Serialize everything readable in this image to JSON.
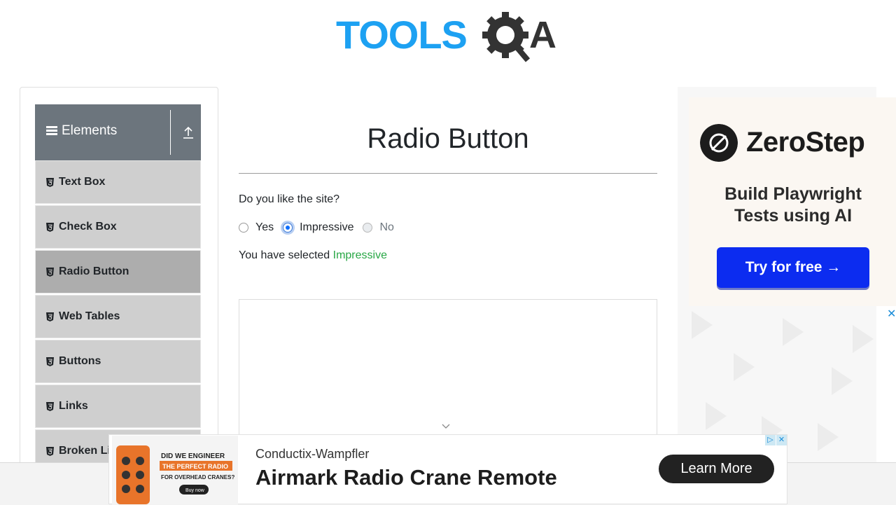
{
  "logo": {
    "text_left": "TOOLS",
    "text_right": "A",
    "primary_color": "#1da1f2",
    "dark_color": "#333333"
  },
  "sidebar": {
    "group_title": "Elements",
    "items": [
      {
        "label": "Text Box",
        "active": false
      },
      {
        "label": "Check Box",
        "active": false
      },
      {
        "label": "Radio Button",
        "active": true
      },
      {
        "label": "Web Tables",
        "active": false
      },
      {
        "label": "Buttons",
        "active": false
      },
      {
        "label": "Links",
        "active": false
      },
      {
        "label": "Broken Li",
        "active": false
      }
    ]
  },
  "main": {
    "title": "Radio Button",
    "question": "Do you like the site?",
    "options": [
      {
        "label": "Yes",
        "state": "unchecked"
      },
      {
        "label": "Impressive",
        "state": "checked"
      },
      {
        "label": "No",
        "state": "disabled"
      }
    ],
    "result_prefix": "You have selected ",
    "result_value": "Impressive",
    "result_color": "#28a745"
  },
  "right_ad": {
    "brand": "ZeroStep",
    "tagline": "Build Playwright Tests using AI",
    "button": "Try for free →",
    "close": "✕",
    "button_color": "#0c2cf0"
  },
  "bottom_ad": {
    "image_line1": "DID WE ENGINEER",
    "image_line2": "THE PERFECT RADIO",
    "image_line3": "FOR OVERHEAD CRANES?",
    "image_button": "Buy now",
    "brand": "Conductix-Wampfler",
    "title": "Airmark Radio Crane Remote",
    "cta": "Learn More"
  }
}
